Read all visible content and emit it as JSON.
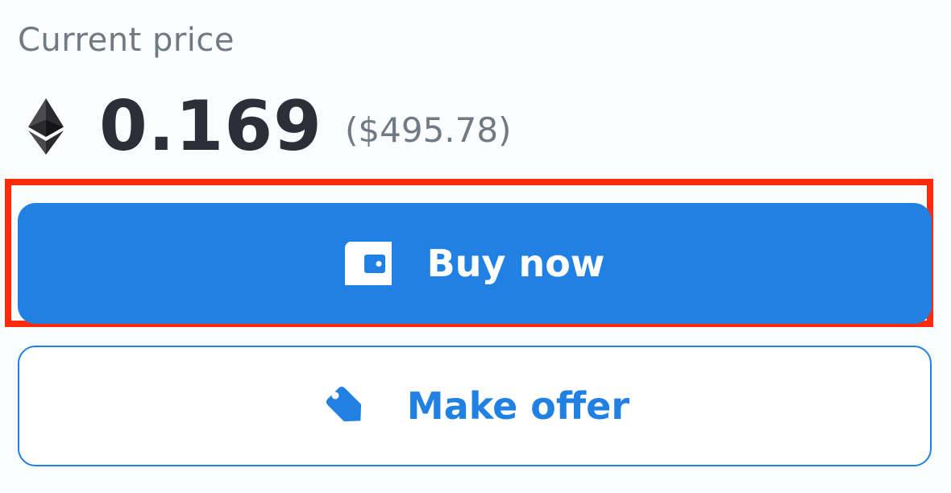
{
  "price": {
    "label": "Current price",
    "currency_icon": "ethereum-icon",
    "value": "0.169",
    "usd": "($495.78)"
  },
  "actions": {
    "buy_label": "Buy now",
    "buy_icon": "wallet-icon",
    "offer_label": "Make offer",
    "offer_icon": "tag-icon"
  },
  "colors": {
    "accent": "#2081e2",
    "highlight": "#ff2a0a",
    "text_dark": "#2c2f38",
    "text_muted": "#707a83"
  }
}
